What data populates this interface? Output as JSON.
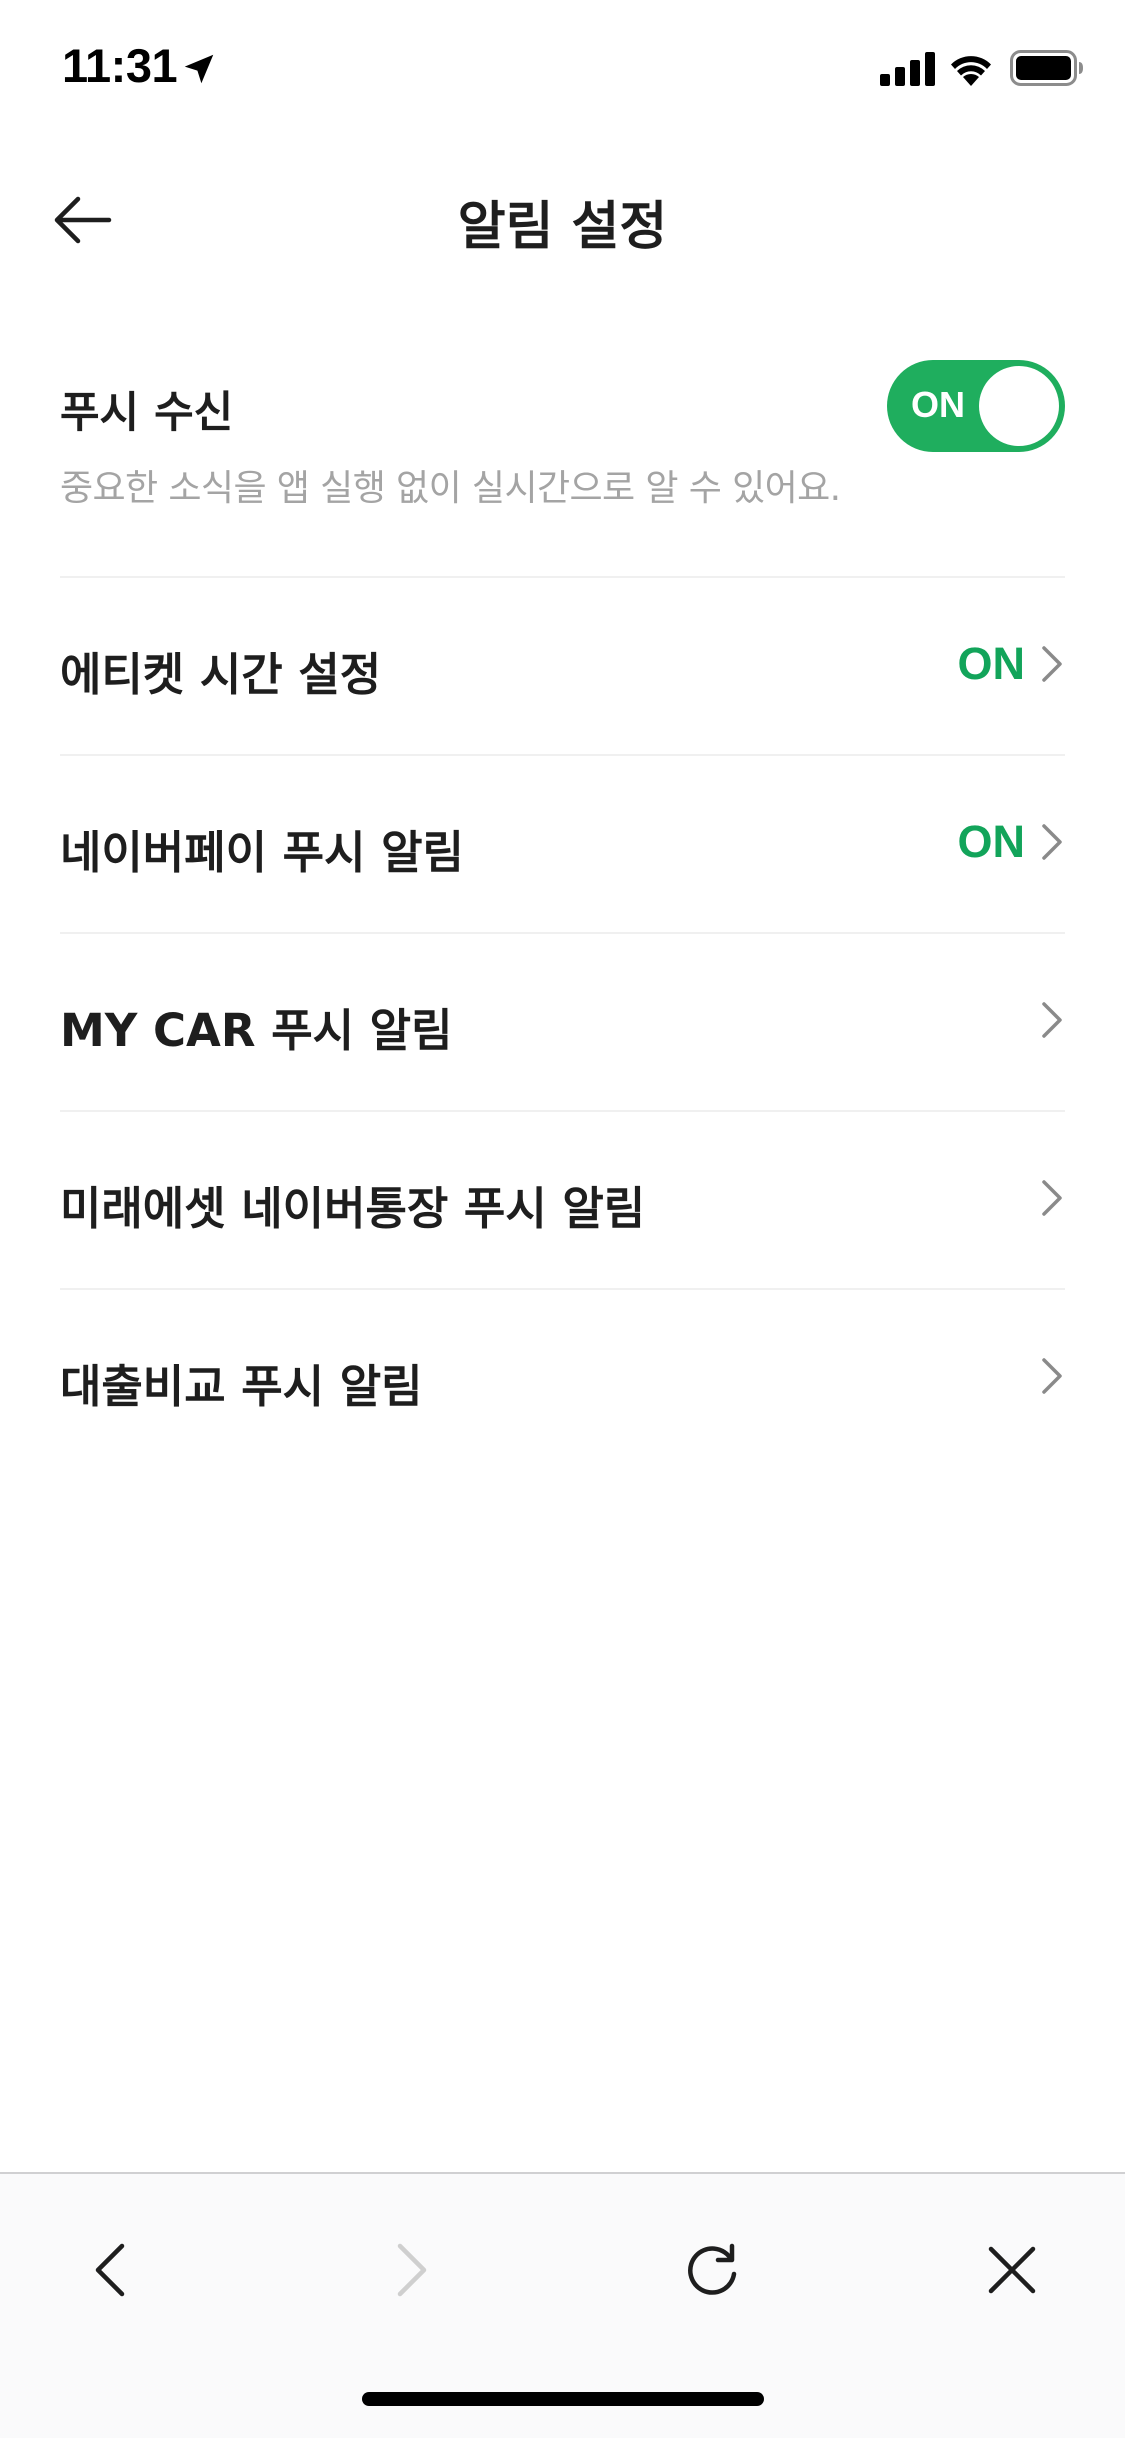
{
  "status_bar": {
    "time": "11:31"
  },
  "header": {
    "title": "알림 설정"
  },
  "push_section": {
    "title": "푸시 수신",
    "description": "중요한 소식을 앱 실행 없이 실시간으로 알 수 있어요.",
    "toggle_label": "ON",
    "toggle_state": "on"
  },
  "menu": {
    "items": [
      {
        "label": "에티켓 시간 설정",
        "status": "ON"
      },
      {
        "label": "네이버페이 푸시 알림",
        "status": "ON"
      },
      {
        "label": "MY CAR 푸시 알림",
        "status": ""
      },
      {
        "label": "미래에셋 네이버통장 푸시 알림",
        "status": ""
      },
      {
        "label": "대출비교 푸시 알림",
        "status": ""
      }
    ]
  },
  "colors": {
    "accent_green": "#1fae5e",
    "status_green": "#12a45a",
    "text_primary": "#1e1e1e",
    "text_secondary": "#a4a4a4"
  },
  "icons": {
    "status": [
      "location-arrow-icon",
      "signal-icon",
      "wifi-icon",
      "battery-icon"
    ],
    "header": [
      "back-arrow-icon"
    ],
    "bottom_bar": [
      "chevron-left-icon",
      "chevron-right-icon",
      "refresh-icon",
      "close-icon"
    ]
  }
}
